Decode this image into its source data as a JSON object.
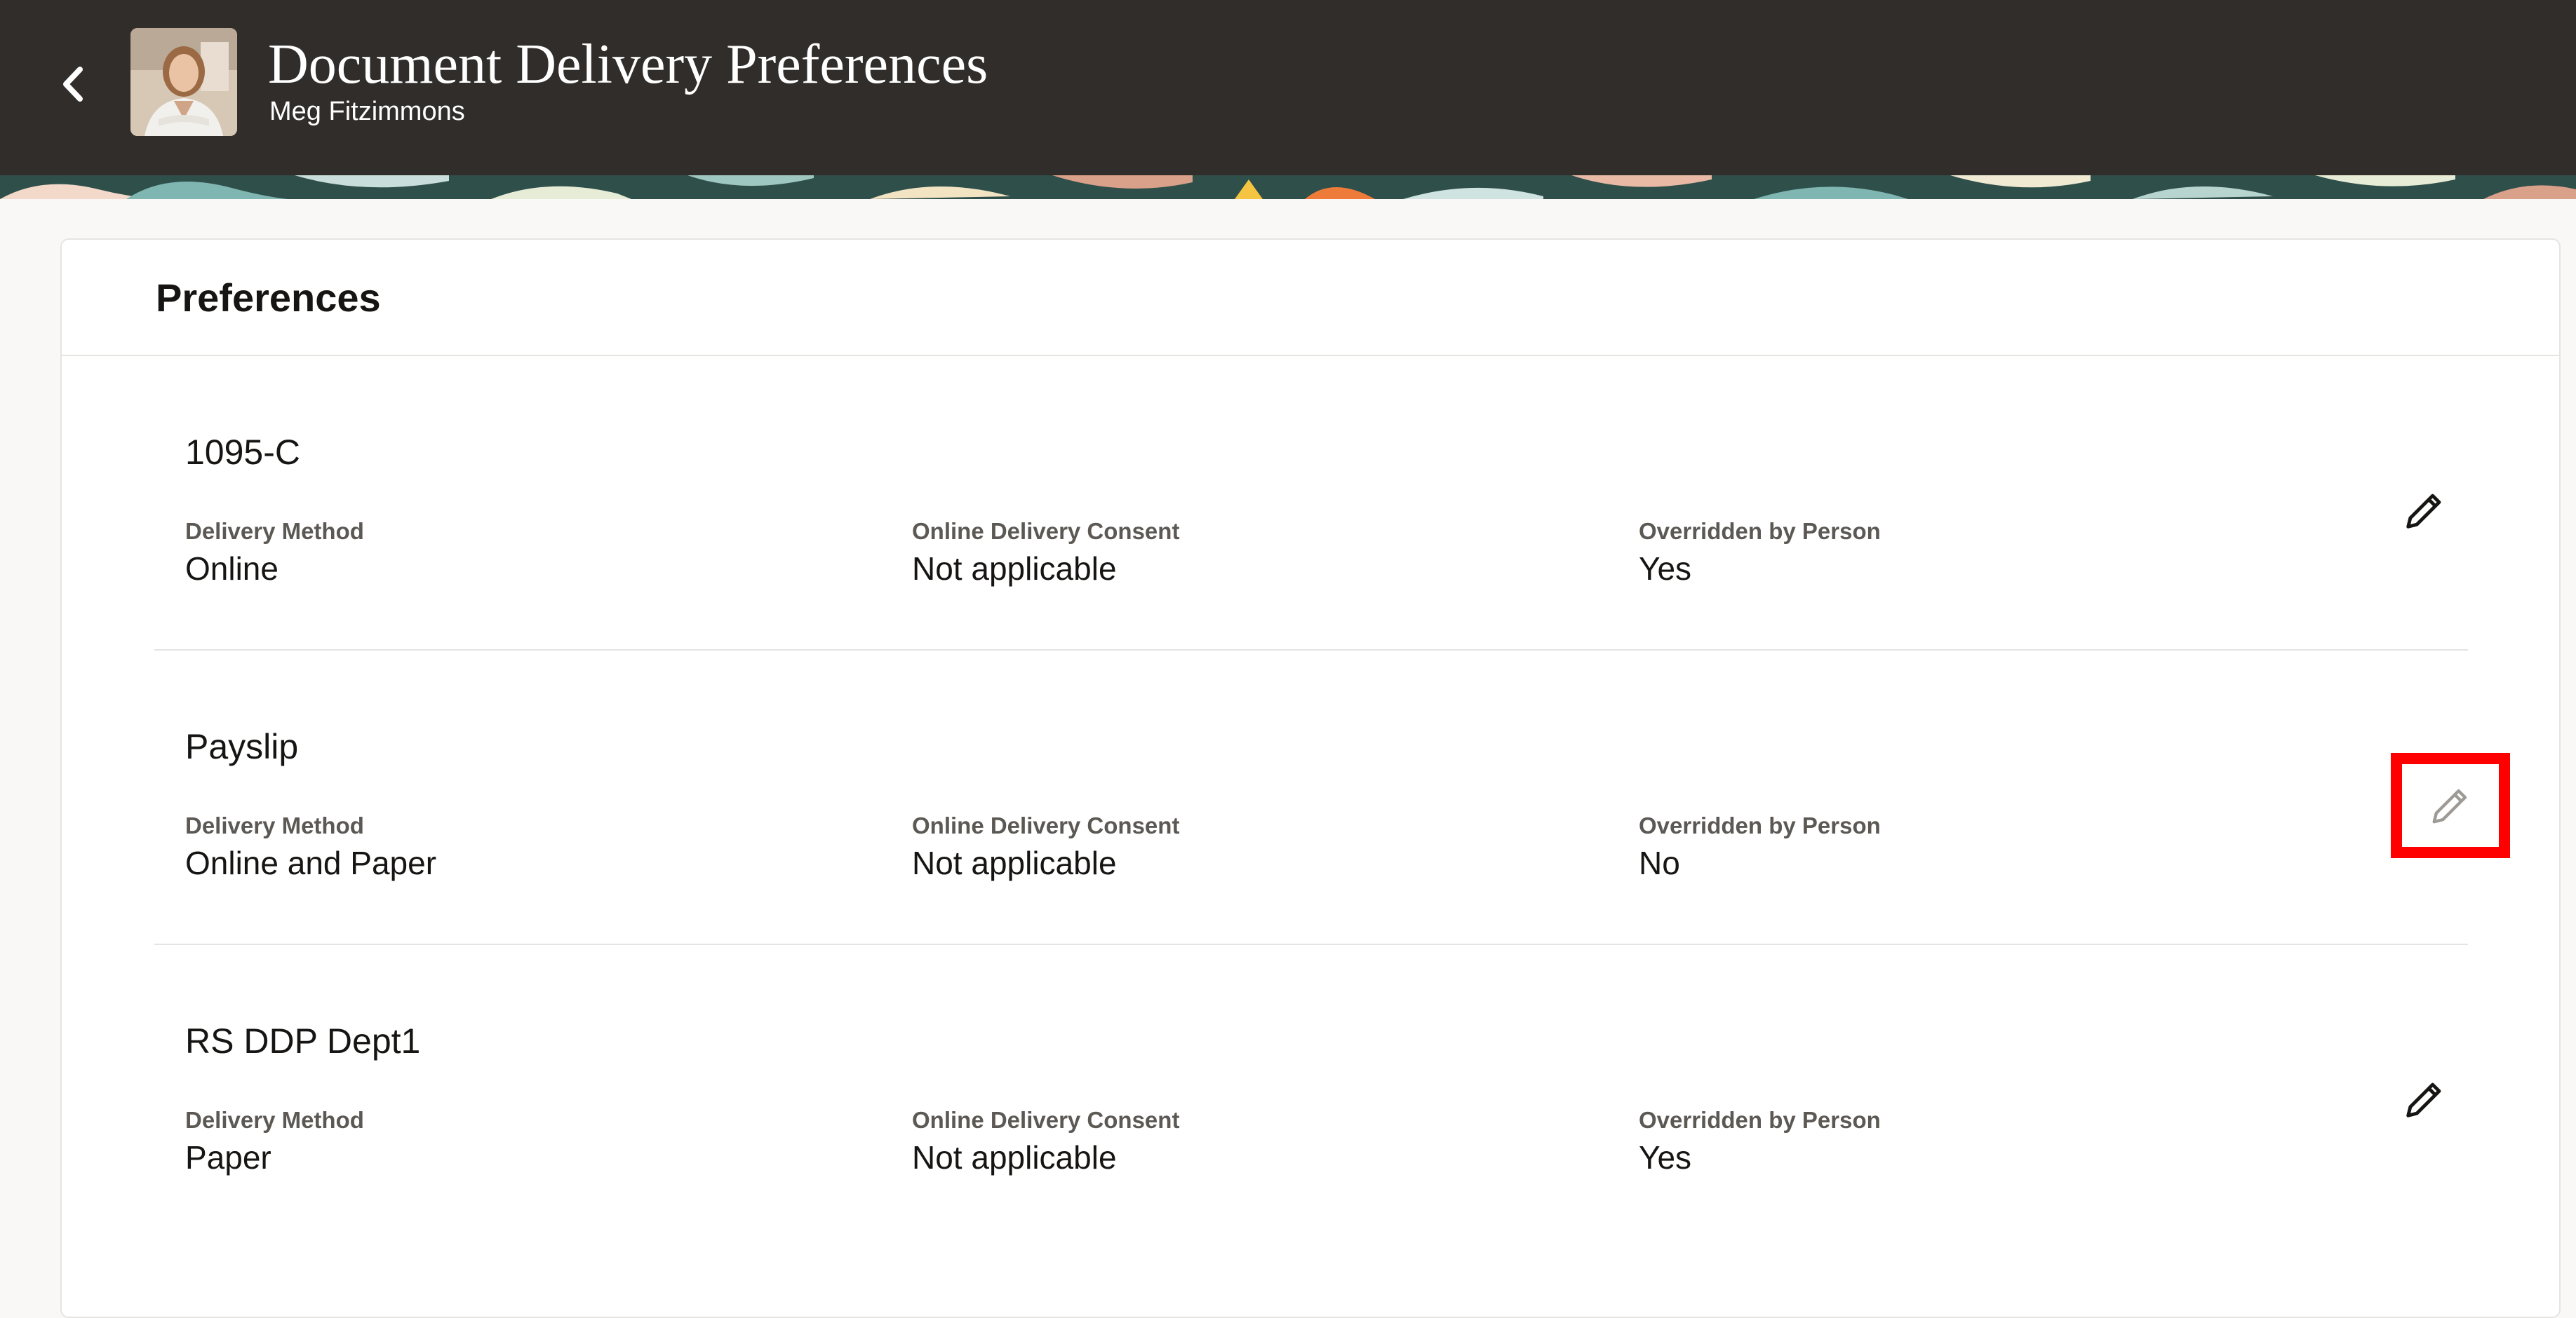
{
  "header": {
    "title": "Document Delivery Preferences",
    "subtitle": "Meg Fitzimmons",
    "back_icon": "chevron-left-icon",
    "avatar": "person-photo"
  },
  "colors": {
    "header_bg": "#312d2a",
    "page_bg": "#f9f8f6",
    "highlight": "#ff0000"
  },
  "card": {
    "title": "Preferences"
  },
  "preferences": [
    {
      "name": "1095-C",
      "delivery_method_label": "Delivery Method",
      "delivery_method": "Online",
      "consent_label": "Online Delivery Consent",
      "consent": "Not applicable",
      "overridden_label": "Overridden by Person",
      "overridden": "Yes",
      "edit_icon": "pencil-icon"
    },
    {
      "name": "Payslip",
      "delivery_method_label": "Delivery Method",
      "delivery_method": "Online and Paper",
      "consent_label": "Online Delivery Consent",
      "consent": "Not applicable",
      "overridden_label": "Overridden by Person",
      "overridden": "No",
      "edit_icon": "pencil-icon"
    },
    {
      "name": "RS DDP Dept1",
      "delivery_method_label": "Delivery Method",
      "delivery_method": "Paper",
      "consent_label": "Online Delivery Consent",
      "consent": "Not applicable",
      "overridden_label": "Overridden by Person",
      "overridden": "Yes",
      "edit_icon": "pencil-icon"
    }
  ]
}
